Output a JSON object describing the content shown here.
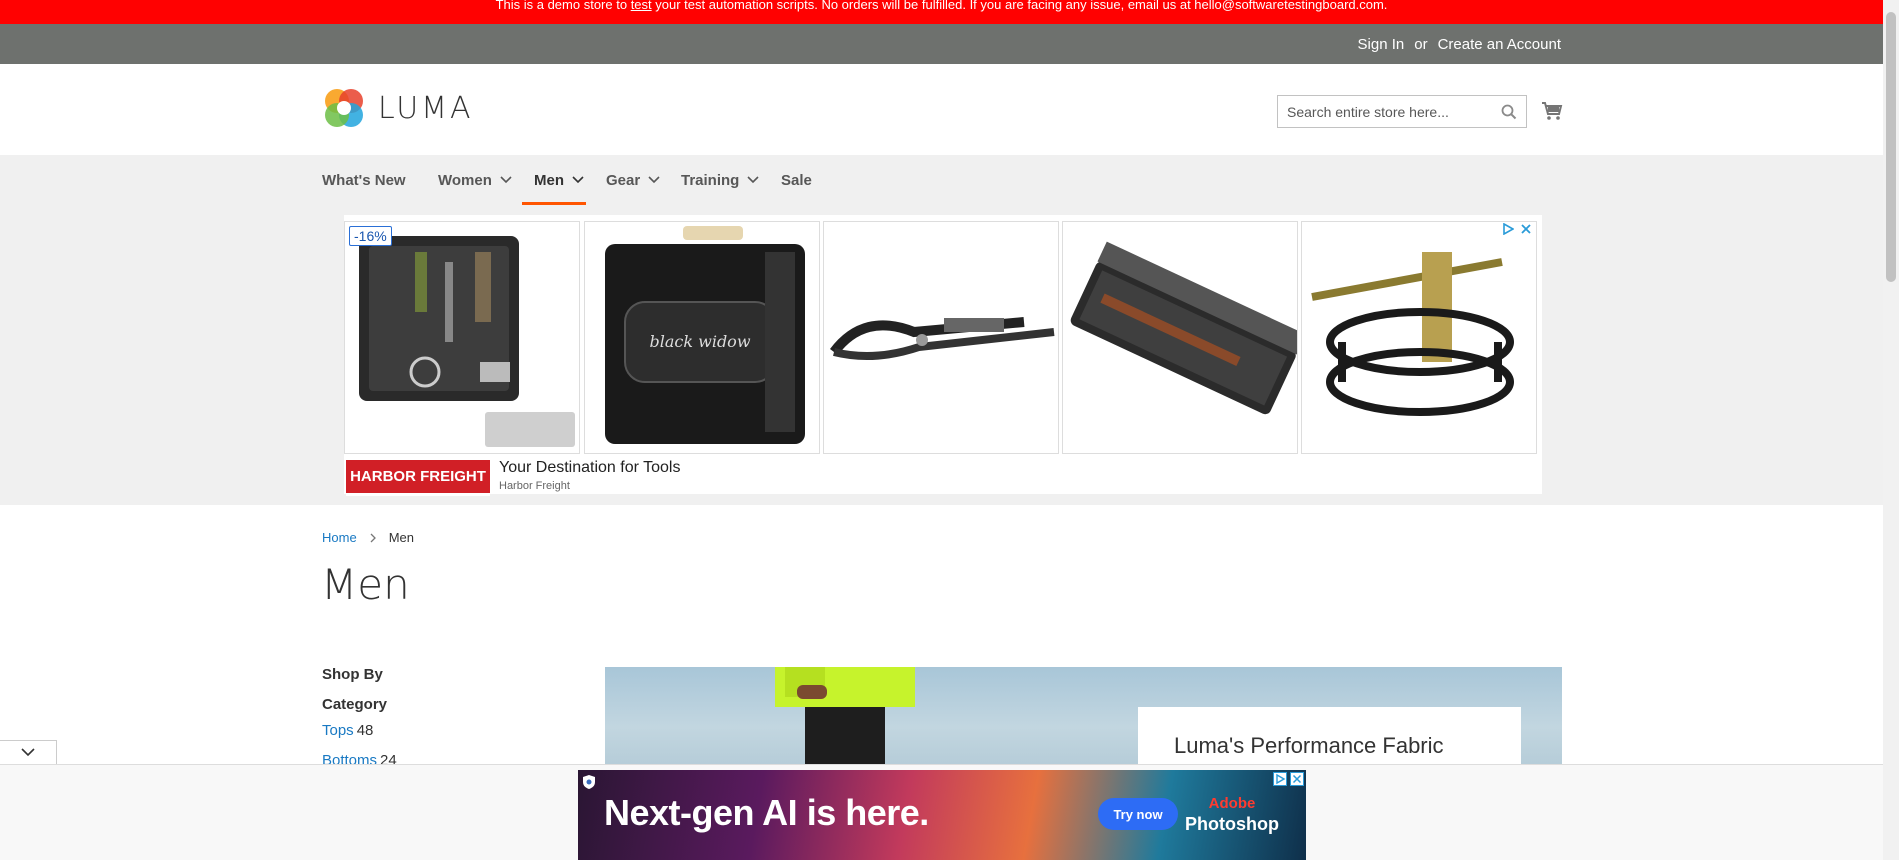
{
  "notice": {
    "pre": "This is a demo store to ",
    "link": "test",
    "post": " your test automation scripts. No orders will be fulfilled. If you are facing any issue, email us at hello@softwaretestingboard.com."
  },
  "header_panel": {
    "sign_in": "Sign In",
    "or": "or",
    "create_account": "Create an Account"
  },
  "brand": {
    "name": "LUMA"
  },
  "search": {
    "placeholder": "Search entire store here..."
  },
  "nav": {
    "items": [
      {
        "label": "What's New"
      },
      {
        "label": "Women"
      },
      {
        "label": "Men"
      },
      {
        "label": "Gear"
      },
      {
        "label": "Training"
      },
      {
        "label": "Sale"
      }
    ],
    "active": "Men"
  },
  "ad_top": {
    "badge": "-16%",
    "logo": "HARBOR FREIGHT",
    "title": "Your Destination for Tools",
    "advertiser": "Harbor Freight"
  },
  "breadcrumbs": {
    "home": "Home",
    "current": "Men"
  },
  "page": {
    "title": "Men"
  },
  "sidebar": {
    "shop_by": "Shop By",
    "filter_title": "Category",
    "filters": [
      {
        "label": "Tops",
        "count": "48"
      },
      {
        "label": "Bottoms",
        "count": "24"
      }
    ]
  },
  "hero": {
    "card_title": "Luma's Performance Fabric"
  },
  "ad_bottom": {
    "headline": "Next-gen AI is here.",
    "cta": "Try now",
    "brand_line1": "Adobe",
    "brand_line2": "Photoshop"
  },
  "colors": {
    "notice_bg": "#ff0101",
    "panel_bg": "#6e716e",
    "nav_bg": "#f0f0f0",
    "nav_active_underline": "#ff5501",
    "link": "#1979c3"
  }
}
